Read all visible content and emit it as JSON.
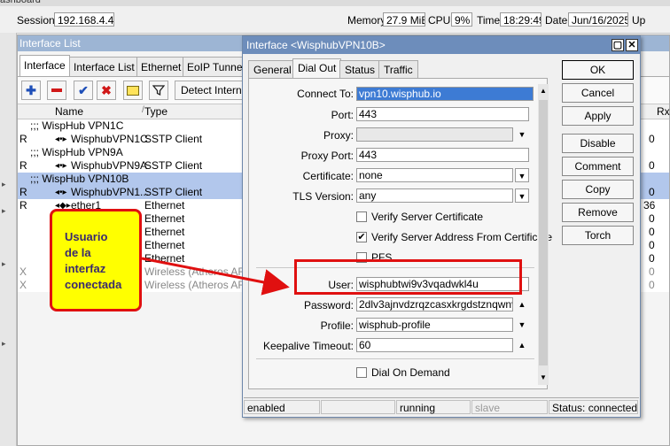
{
  "window_strip": "ashboard",
  "statusbar": {
    "session_label": "Session:",
    "session_value": "192.168.4.48",
    "memory_label": "Memory:",
    "memory_value": "27.9 MiB",
    "cpu_label": "CPU:",
    "cpu_value": "9%",
    "time_label": "Time:",
    "time_value": "18:29:49",
    "date_label": "Date:",
    "date_value": "Jun/16/2025",
    "extra": "Up"
  },
  "iflist": {
    "title": "Interface List",
    "tabs": [
      "Interface",
      "Interface List",
      "Ethernet",
      "EoIP Tunnel"
    ],
    "detect_label": "Detect Interne",
    "columns": {
      "name": "Name",
      "type": "Type",
      "rx": "Rx"
    },
    "rows": [
      {
        "flag": "",
        "name": ";;; WispHub VPN1C",
        "type": "",
        "rx": ""
      },
      {
        "flag": "R",
        "name": "WisphubVPN1C",
        "type": "SSTP Client",
        "rx": "0"
      },
      {
        "flag": "",
        "name": ";;; WispHub VPN9A",
        "type": "",
        "rx": ""
      },
      {
        "flag": "R",
        "name": "WisphubVPN9A",
        "type": "SSTP Client",
        "rx": "0"
      },
      {
        "flag": "",
        "name": ";;; WispHub VPN10B",
        "type": "",
        "rx": ""
      },
      {
        "flag": "R",
        "name": "WisphubVPN1...",
        "type": "SSTP Client",
        "rx": "0"
      },
      {
        "flag": "R",
        "name": "ether1",
        "type": "Ethernet",
        "rx": "36"
      },
      {
        "flag": "",
        "name": "",
        "type": "Ethernet",
        "rx": "0"
      },
      {
        "flag": "",
        "name": "",
        "type": "Ethernet",
        "rx": "0"
      },
      {
        "flag": "",
        "name": "",
        "type": "Ethernet",
        "rx": "0"
      },
      {
        "flag": "",
        "name": "",
        "type": "Ethernet",
        "rx": "0"
      },
      {
        "flag": "X",
        "name": "",
        "type": "Wireless (Atheros AR9...",
        "rx": "0"
      },
      {
        "flag": "X",
        "name": "",
        "type": "Wireless (Atheros AR9...",
        "rx": "0"
      }
    ]
  },
  "dialog": {
    "title": "Interface <WisphubVPN10B>",
    "tabs": [
      "General",
      "Dial Out",
      "Status",
      "Traffic"
    ],
    "fields": {
      "connect_to_label": "Connect To:",
      "connect_to_value": "vpn10.wisphub.io",
      "port_label": "Port:",
      "port_value": "443",
      "proxy_label": "Proxy:",
      "proxy_value": "",
      "proxy_port_label": "Proxy Port:",
      "proxy_port_value": "443",
      "certificate_label": "Certificate:",
      "certificate_value": "none",
      "tls_label": "TLS Version:",
      "tls_value": "any",
      "verify_cert_label": "Verify Server Certificate",
      "verify_addr_label": "Verify Server Address From Certificate",
      "pfs_label": "PFS",
      "user_label": "User:",
      "user_value": "wisphubtwi9v3vqadwkl4u",
      "password_label": "Password:",
      "password_value": "2dlv3ajnvdzrqzcasxkrgdstznqwnv",
      "profile_label": "Profile:",
      "profile_value": "wisphub-profile",
      "keepalive_label": "Keepalive Timeout:",
      "keepalive_value": "60",
      "dial_on_demand_label": "Dial On Demand"
    },
    "buttons": [
      "OK",
      "Cancel",
      "Apply",
      "Disable",
      "Comment",
      "Copy",
      "Remove",
      "Torch"
    ],
    "status": {
      "enabled": "enabled",
      "running": "running",
      "slave": "slave",
      "connection": "Status: connected"
    }
  },
  "annotation": {
    "lines": [
      "Usuario",
      "de la",
      "interfaz",
      "conectada"
    ]
  }
}
